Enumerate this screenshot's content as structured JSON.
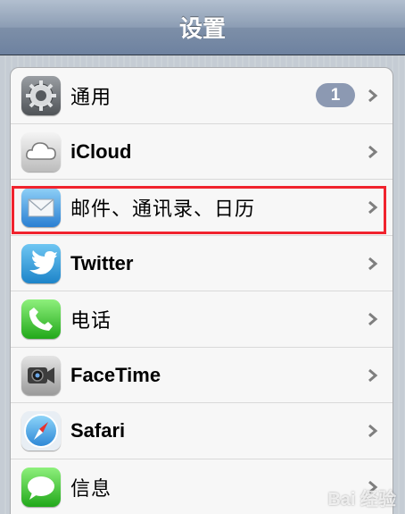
{
  "nav": {
    "title": "设置"
  },
  "rows": [
    {
      "label": "通用",
      "icon": "gear-icon",
      "badge": "1"
    },
    {
      "label": "iCloud",
      "icon": "cloud-icon"
    },
    {
      "label": "邮件、通讯录、日历",
      "icon": "mail-icon"
    },
    {
      "label": "Twitter",
      "icon": "twitter-bird-icon"
    },
    {
      "label": "电话",
      "icon": "phone-icon"
    },
    {
      "label": "FaceTime",
      "icon": "video-camera-icon"
    },
    {
      "label": "Safari",
      "icon": "compass-icon"
    },
    {
      "label": "信息",
      "icon": "speech-bubble-icon"
    }
  ],
  "watermark": "Bai 经验",
  "colors": {
    "highlight": "#f0232e",
    "badge": "#8c99b2"
  }
}
